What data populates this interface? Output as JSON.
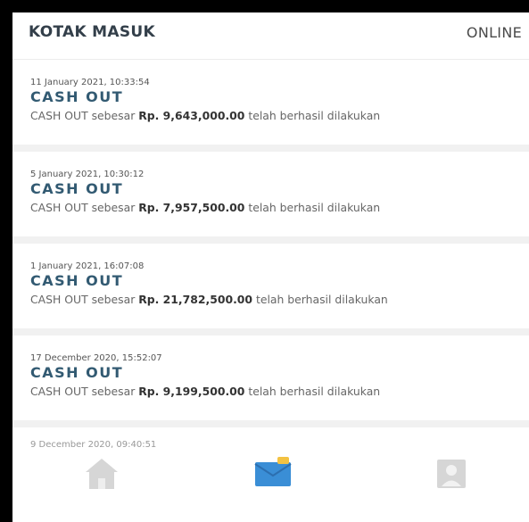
{
  "header": {
    "title": "KOTAK MASUK",
    "status": "ONLINE"
  },
  "messages": [
    {
      "date": "11 January 2021, 10:33:54",
      "title": "CASH OUT",
      "body_prefix": "CASH OUT sebesar",
      "amount": "Rp. 9,643,000.00",
      "body_suffix": "telah berhasil dilakukan"
    },
    {
      "date": "5 January 2021, 10:30:12",
      "title": "CASH OUT",
      "body_prefix": "CASH OUT sebesar",
      "amount": "Rp. 7,957,500.00",
      "body_suffix": "telah berhasil dilakukan"
    },
    {
      "date": "1 January 2021, 16:07:08",
      "title": "CASH OUT",
      "body_prefix": "CASH OUT sebesar",
      "amount": "Rp. 21,782,500.00",
      "body_suffix": "telah berhasil dilakukan"
    },
    {
      "date": "17 December 2020, 15:52:07",
      "title": "CASH OUT",
      "body_prefix": "CASH OUT sebesar",
      "amount": "Rp. 9,199,500.00",
      "body_suffix": "telah berhasil dilakukan"
    }
  ],
  "partial_message": {
    "date": "9 December 2020, 09:40:51"
  },
  "tabbar": {
    "items": [
      {
        "icon": "home-icon",
        "active": false
      },
      {
        "icon": "inbox-icon",
        "active": true
      },
      {
        "icon": "profile-icon",
        "active": false
      }
    ]
  },
  "colors": {
    "accent": "#325a72",
    "inbox_icon": "#3a8ed6",
    "inbox_badge": "#f3c242",
    "inactive_icon": "#d6d6d6"
  }
}
